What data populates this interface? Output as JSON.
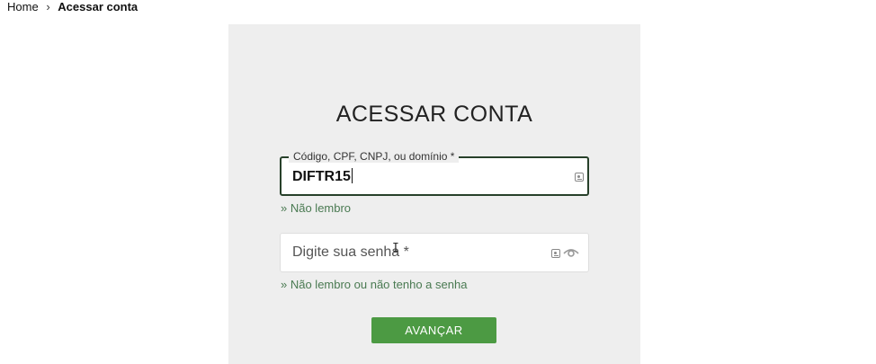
{
  "breadcrumb": {
    "home": "Home",
    "separator": "›",
    "current": "Acessar conta"
  },
  "panel": {
    "title": "ACESSAR CONTA"
  },
  "code_field": {
    "label": "Código, CPF, CNPJ, ou domínio *",
    "value": "DIFTR15",
    "icon": "id-card-icon"
  },
  "forgot_code_link": "» Não lembro",
  "password_field": {
    "placeholder": "Digite sua senha *",
    "icons": [
      "id-card-icon",
      "eye-icon"
    ]
  },
  "forgot_password_link": "» Não lembro ou não tenho a senha",
  "submit_button": "AVANÇAR",
  "colors": {
    "panel_bg": "#eeeeee",
    "accent_green": "#4c9a43",
    "link_green": "#4a7a52",
    "focused_border": "#27402a"
  }
}
